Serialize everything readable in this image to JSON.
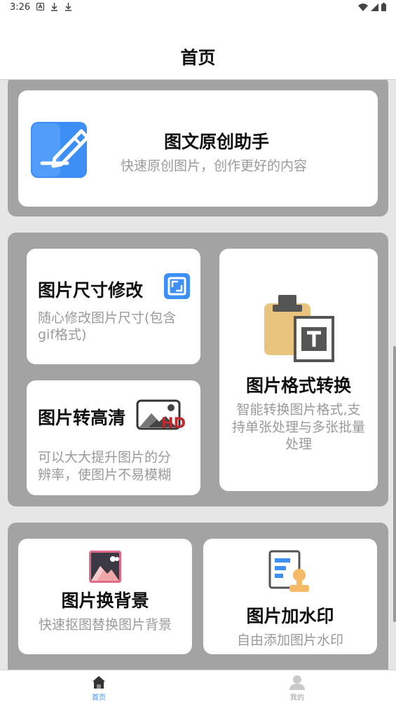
{
  "status": {
    "time": "3:26"
  },
  "header": {
    "title": "首页"
  },
  "cards": {
    "assistant": {
      "title": "图文原创助手",
      "subtitle": "快速原创图片，创作更好的内容"
    },
    "resize": {
      "title": "图片尺寸修改",
      "subtitle_line1": "随心修改图片尺寸(包含",
      "subtitle_line2": "gif格式)"
    },
    "hd": {
      "title": "图片转高清",
      "badge": "HD",
      "subtitle_line1": "可以大大提升图片的分",
      "subtitle_line2": "辨率，使图片不易模糊"
    },
    "convert": {
      "title": "图片格式转换",
      "subtitle_line1": "智能转换图片格式,支",
      "subtitle_line2": "持单张处理与多张批量",
      "subtitle_line3": "处理"
    },
    "background": {
      "title": "图片换背景",
      "subtitle": "快速抠图替换图片背景"
    },
    "watermark": {
      "title": "图片加水印",
      "subtitle": "自由添加图片水印"
    }
  },
  "tabs": [
    {
      "label": "首页",
      "icon": "home-icon",
      "active": true
    },
    {
      "label": "我的",
      "icon": "user-icon",
      "active": false
    }
  ],
  "colors": {
    "accent": "#3d8ff5",
    "section": "#a3a3a3",
    "background": "#e6e6e6",
    "hd_red": "#c0282c"
  }
}
